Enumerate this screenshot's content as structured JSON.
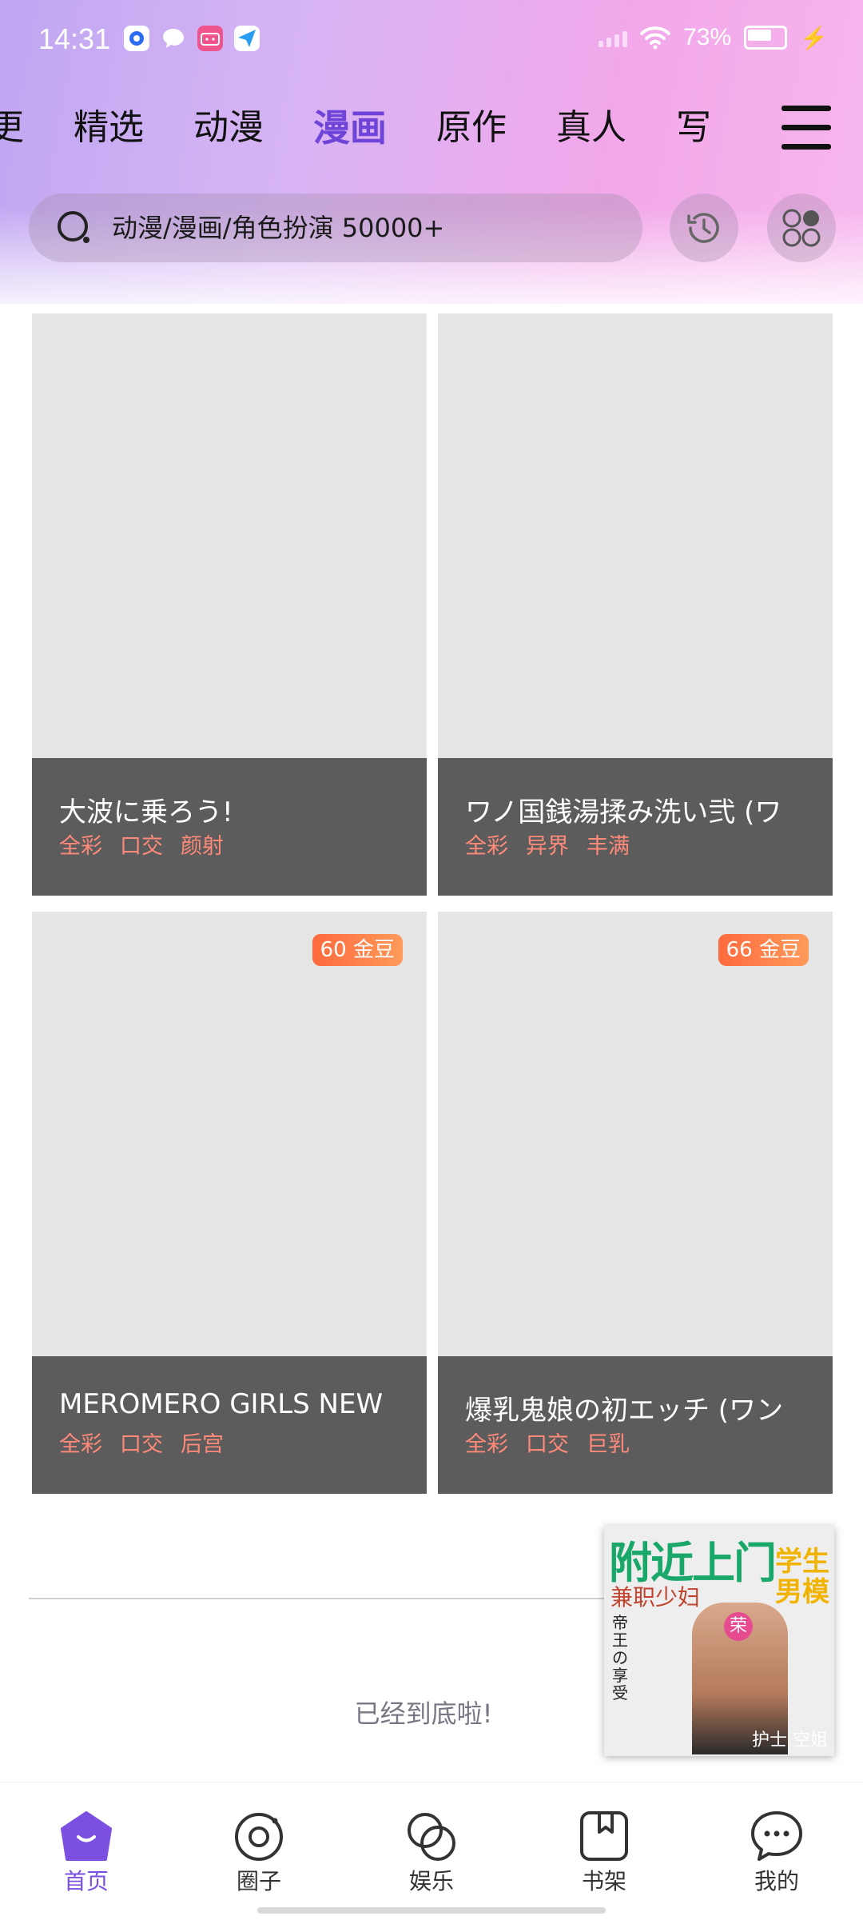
{
  "status_bar": {
    "time": "14:31",
    "battery_percent": "73%",
    "battery_level": 0.73,
    "app_icons": [
      "app-circle-icon",
      "chat-bubble-icon",
      "bilibili-icon",
      "send-icon"
    ]
  },
  "tabs": [
    {
      "label": "更"
    },
    {
      "label": "精选"
    },
    {
      "label": "动漫"
    },
    {
      "label": "漫画",
      "active": true
    },
    {
      "label": "原作"
    },
    {
      "label": "真人"
    },
    {
      "label": "写"
    }
  ],
  "search": {
    "placeholder": "动漫/漫画/角色扮演 50000+"
  },
  "cards": [
    {
      "title": "大波に乗ろう!",
      "tags": [
        "全彩",
        "口交",
        "颜射"
      ],
      "price": ""
    },
    {
      "title": "ワノ国銭湯揉み洗い弐 (ワ",
      "tags": [
        "全彩",
        "异界",
        "丰满"
      ],
      "price": ""
    },
    {
      "title": "MEROMERO GIRLS NEW",
      "tags": [
        "全彩",
        "口交",
        "后宫"
      ],
      "price": "60 金豆"
    },
    {
      "title": "爆乳鬼娘の初エッチ (ワン",
      "tags": [
        "全彩",
        "口交",
        "巨乳"
      ],
      "price": "66 金豆"
    }
  ],
  "end_message": "已经到底啦!",
  "ad": {
    "headline": "附近上门",
    "side_text": "学生男模",
    "subline": "兼职少妇",
    "badge": "荣",
    "vertical_text": "帝王の享受",
    "footer": "护士 空姐"
  },
  "bottom_nav": [
    {
      "label": "首页",
      "icon": "home-icon",
      "active": true
    },
    {
      "label": "圈子",
      "icon": "circle-icon"
    },
    {
      "label": "娱乐",
      "icon": "entertainment-icon"
    },
    {
      "label": "书架",
      "icon": "bookshelf-icon"
    },
    {
      "label": "我的",
      "icon": "chat-profile-icon"
    }
  ],
  "colors": {
    "accent": "#7b4fe0",
    "tag": "#ff8a7a",
    "price_badge": "#ff6a3d"
  }
}
